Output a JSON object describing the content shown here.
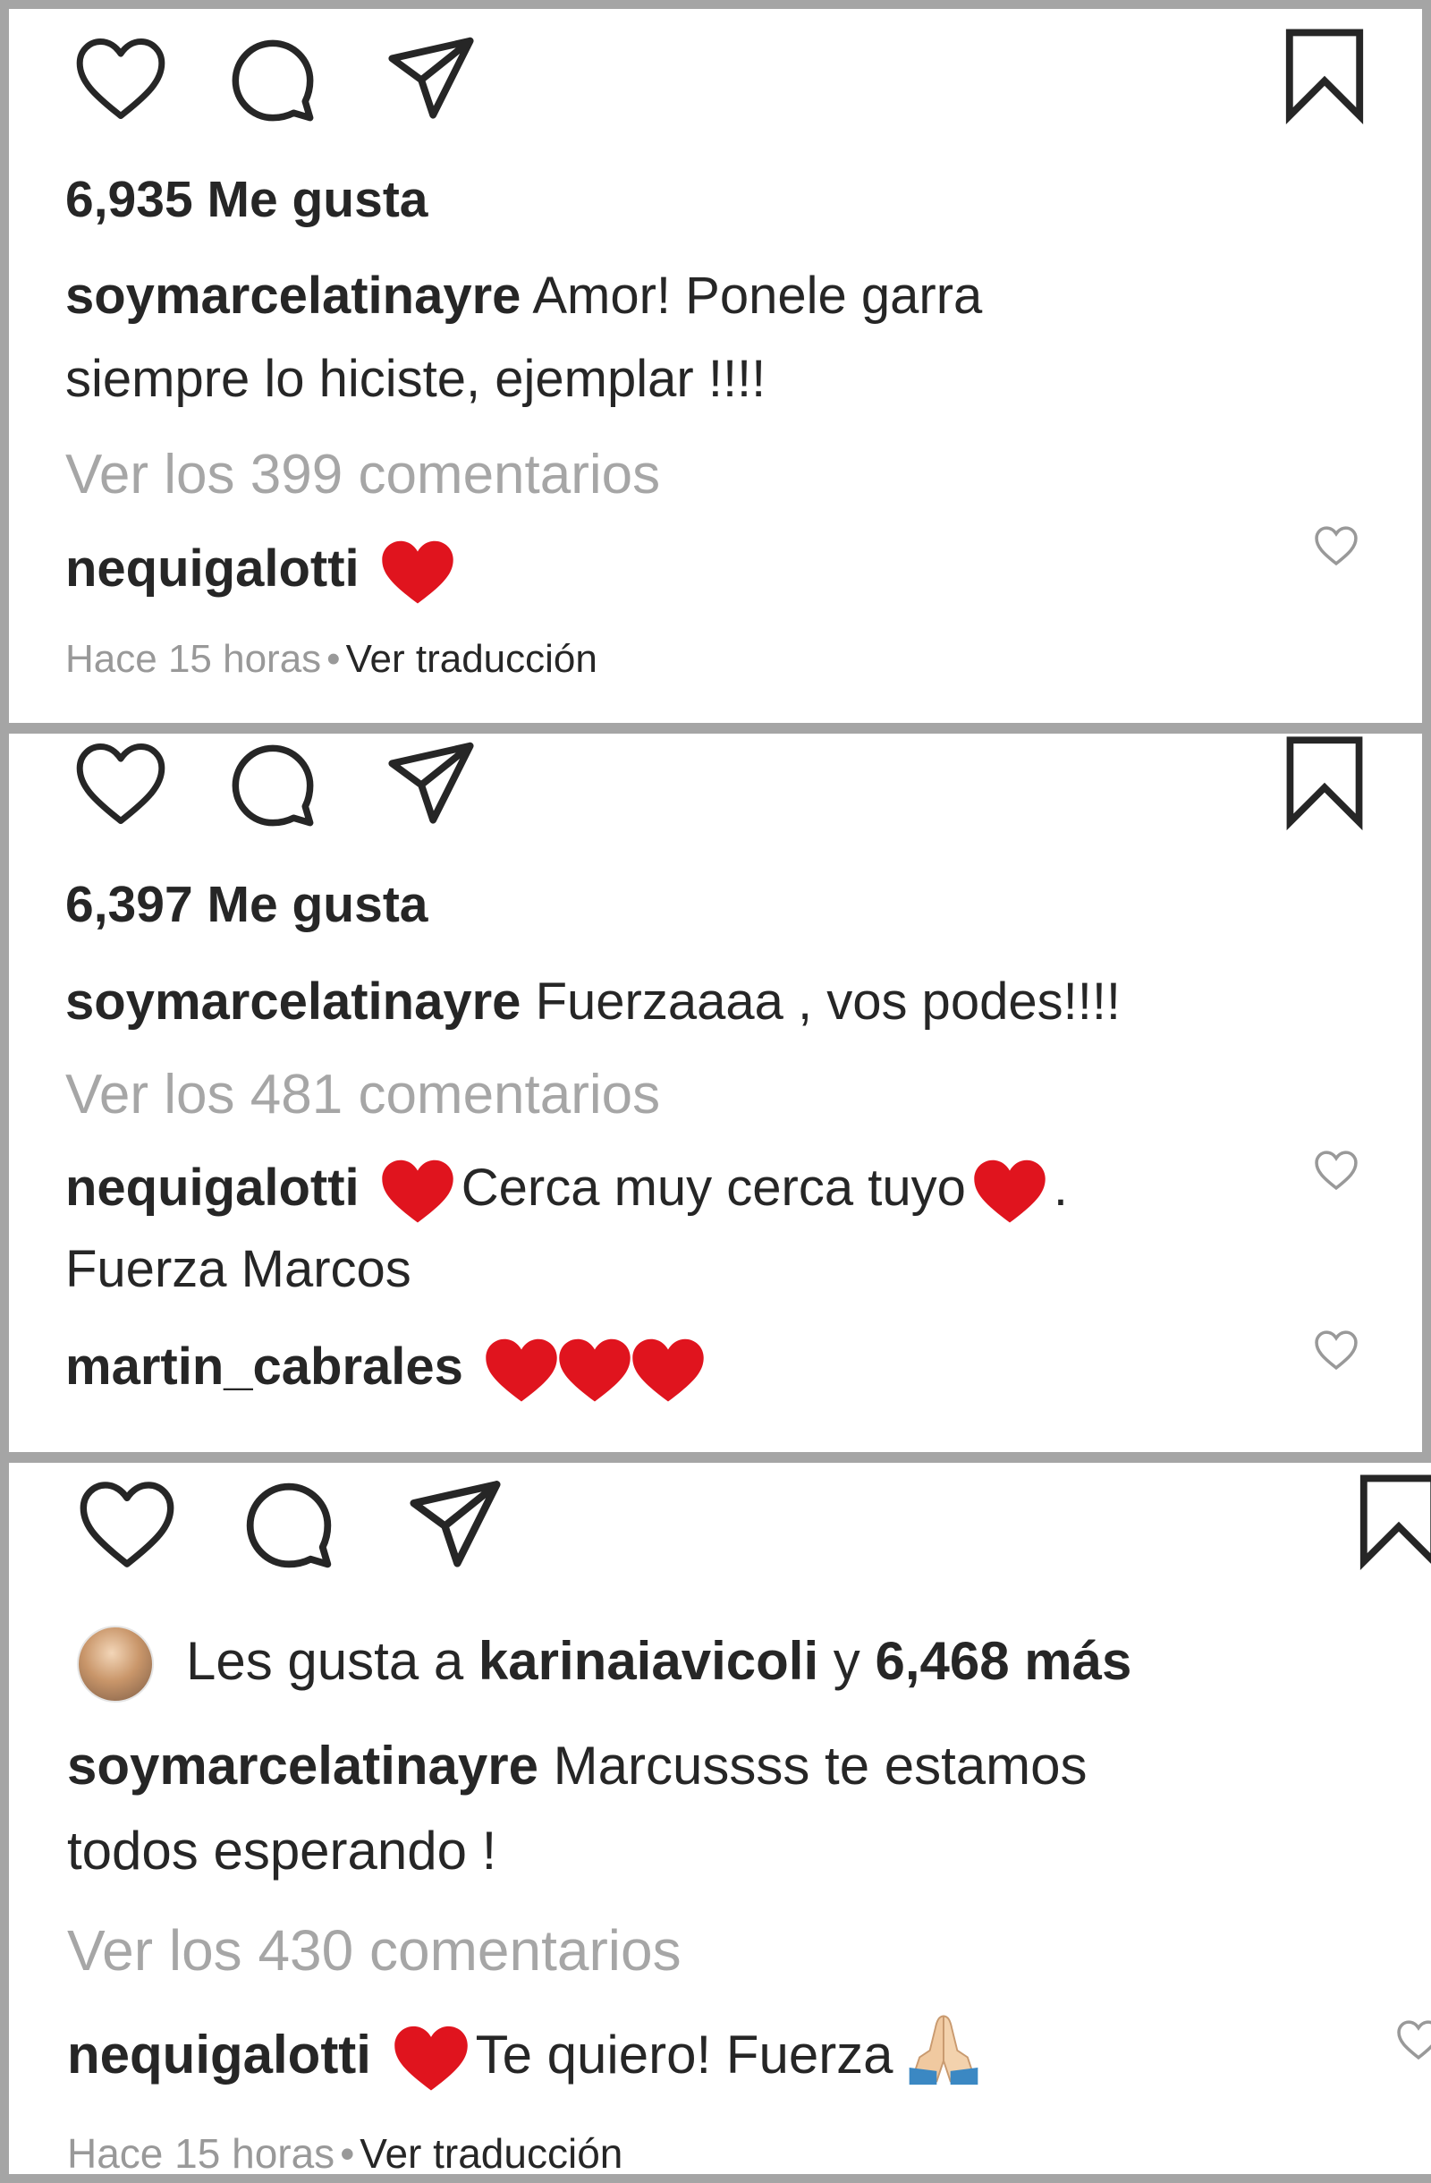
{
  "posts": [
    {
      "likes": "6,935 Me gusta",
      "caption_user": "soymarcelatinayre",
      "caption_text_1": "Amor! Ponele garra",
      "caption_text_2": "siempre lo hiciste, ejemplar !!!!",
      "view_comments": "Ver los 399 comentarios",
      "comment_user": "nequigalotti",
      "time": "Hace 15 horas",
      "separator": "•",
      "translate": "Ver traducción"
    },
    {
      "likes": "6,397 Me gusta",
      "caption_user": "soymarcelatinayre",
      "caption_text": "Fuerzaaaa , vos podes!!!!",
      "view_comments": "Ver los 481 comentarios",
      "comment1_user": "nequigalotti",
      "comment1_text_a": "Cerca muy cerca tuyo",
      "comment1_text_b": ".",
      "comment1_text_2": "Fuerza Marcos",
      "comment2_user": "martin_cabrales"
    },
    {
      "liked_by_prefix": "Les gusta a",
      "liked_by_user": "karinaiavicoli",
      "liked_by_conj": "y",
      "liked_by_count": "6,468 más",
      "caption_user": "soymarcelatinayre",
      "caption_text_1": "Marcussss te estamos",
      "caption_text_2": "todos esperando !",
      "view_comments": "Ver los 430 comentarios",
      "comment_user": "nequigalotti",
      "comment_text": "Te quiero! Fuerza",
      "time": "Hace 15 horas",
      "separator": "•",
      "translate": "Ver traducción"
    }
  ],
  "colors": {
    "text": "#262626",
    "muted": "#a6a6a6",
    "heart_emoji": "#e0141e",
    "frame": "#a5a5a5"
  },
  "icons": [
    "heart-outline-icon",
    "comment-icon",
    "share-icon",
    "bookmark-icon",
    "small-heart-icon",
    "red-heart-emoji",
    "folded-hands-emoji"
  ]
}
